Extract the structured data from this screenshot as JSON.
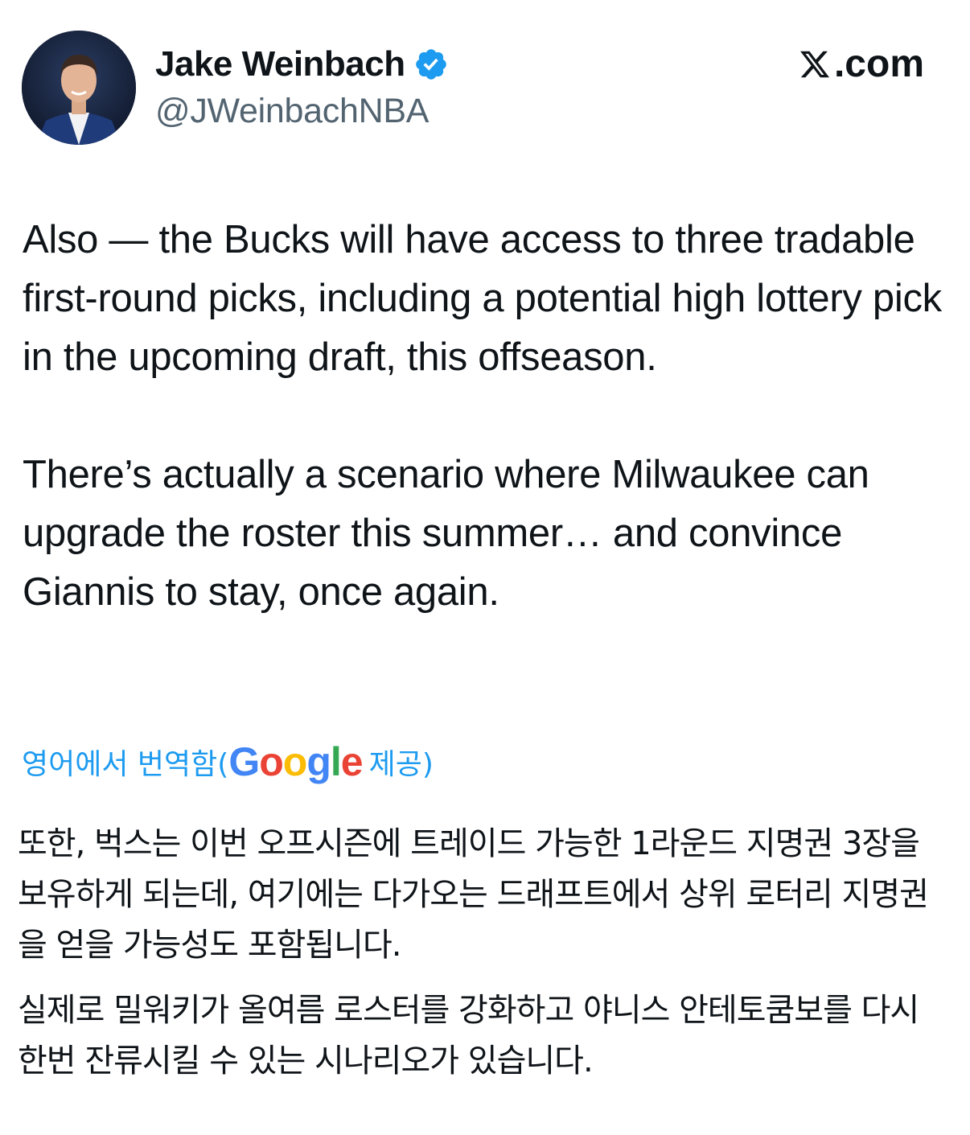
{
  "author": {
    "name": "Jake Weinbach",
    "handle": "@JWeinbachNBA",
    "verified_color": "#1d9bf0",
    "avatar_icon": "profile-photo"
  },
  "brand": {
    "text": ".com",
    "icon": "x-logo-icon"
  },
  "tweet": {
    "paragraph_1": "Also — the Bucks will have access to three tradable first-round picks, including a potential high lottery pick in the upcoming draft, this offseason.",
    "paragraph_2": "There’s actually a scenario where Milwaukee can upgrade the roster this summer… and convince Giannis to stay, once again."
  },
  "translation_note": {
    "prefix": "영어에서 번역함(",
    "provider_letters": [
      "G",
      "o",
      "o",
      "g",
      "l",
      "e"
    ],
    "suffix": "제공)",
    "color": "#1d9bf0"
  },
  "translation": {
    "paragraph_1": "또한, 벅스는 이번 오프시즌에 트레이드 가능한 1라운드 지명권 3장을 보유하게 되는데, 여기에는 다가오는 드래프트에서 상위 로터리 지명권을 얻을 가능성도 포함됩니다.",
    "paragraph_2": "실제로 밀워키가 올여름 로스터를 강화하고 야니스 안테토쿰보를 다시 한번 잔류시킬 수 있는 시나리오가 있습니다."
  }
}
